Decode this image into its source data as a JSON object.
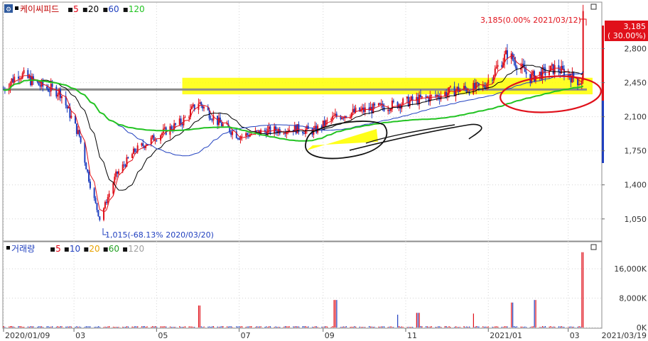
{
  "price_panel": {
    "stock_name": "케이씨피드",
    "corner_icon": "chart-settings-icon",
    "ma_legend": [
      {
        "label": "5",
        "color": "#e60012"
      },
      {
        "label": "20",
        "color": "#000000"
      },
      {
        "label": "60",
        "color": "#1f3fbf"
      },
      {
        "label": "120",
        "color": "#22c322"
      }
    ],
    "high_annotation": "3,185(0.00% 2021/03/12)",
    "low_annotation": "1,015(-68.13% 2020/03/20)",
    "current_price_tag": {
      "price": "3,185",
      "change": "( 30.00%)"
    }
  },
  "volume_panel": {
    "title": "거래량",
    "ma_legend": [
      {
        "label": "5",
        "color": "#e60012"
      },
      {
        "label": "10",
        "color": "#1f3fbf"
      },
      {
        "label": "20",
        "color": "#e8a200"
      },
      {
        "label": "60",
        "color": "#22a022"
      },
      {
        "label": "120",
        "color": "#a0a0a0"
      }
    ]
  },
  "x_axis": {
    "tick_labels": [
      "2020/01/09",
      "03",
      "05",
      "07",
      "09",
      "11",
      "2021/01",
      "03"
    ],
    "end_label": "2021/03/19"
  },
  "chart_data": [
    {
      "type": "candlestick",
      "title": "케이씨피드",
      "y_axis_ticks": [
        1050,
        1400,
        1750,
        2100,
        2450,
        2800
      ],
      "y_axis_tick_labels": [
        "1,050",
        "1,400",
        "1,750",
        "2,100",
        "2,450",
        "2,800"
      ],
      "ylim": [
        830,
        3270
      ],
      "x_range": [
        "2020/01/09",
        "2021/03/19"
      ],
      "close_series": [
        {
          "date": "2020/01/09",
          "value": 2380
        },
        {
          "date": "2020/01/20",
          "value": 2550
        },
        {
          "date": "2020/02/05",
          "value": 2420
        },
        {
          "date": "2020/02/20",
          "value": 2350
        },
        {
          "date": "2020/03/05",
          "value": 1900
        },
        {
          "date": "2020/03/13",
          "value": 1400
        },
        {
          "date": "2020/03/20",
          "value": 1050
        },
        {
          "date": "2020/04/01",
          "value": 1500
        },
        {
          "date": "2020/04/15",
          "value": 1750
        },
        {
          "date": "2020/05/01",
          "value": 1900
        },
        {
          "date": "2020/05/20",
          "value": 2050
        },
        {
          "date": "2020/06/01",
          "value": 2250
        },
        {
          "date": "2020/06/15",
          "value": 2050
        },
        {
          "date": "2020/07/01",
          "value": 1900
        },
        {
          "date": "2020/07/20",
          "value": 1950
        },
        {
          "date": "2020/08/10",
          "value": 1980
        },
        {
          "date": "2020/08/25",
          "value": 1950
        },
        {
          "date": "2020/09/10",
          "value": 2100
        },
        {
          "date": "2020/09/25",
          "value": 2150
        },
        {
          "date": "2020/10/15",
          "value": 2200
        },
        {
          "date": "2020/11/01",
          "value": 2250
        },
        {
          "date": "2020/11/20",
          "value": 2300
        },
        {
          "date": "2020/12/10",
          "value": 2380
        },
        {
          "date": "2020/12/28",
          "value": 2400
        },
        {
          "date": "2021/01/15",
          "value": 2750
        },
        {
          "date": "2021/02/01",
          "value": 2500
        },
        {
          "date": "2021/02/20",
          "value": 2600
        },
        {
          "date": "2021/03/11",
          "value": 2450
        },
        {
          "date": "2021/03/12",
          "value": 3185
        }
      ],
      "moving_averages": [
        "5",
        "20",
        "60",
        "120"
      ],
      "horizontal_level": 2380,
      "yellow_zone": [
        2330,
        2500
      ],
      "high": {
        "value": 3185,
        "change_pct": 0.0,
        "date": "2021/03/12"
      },
      "low": {
        "value": 1015,
        "change_pct": -68.13,
        "date": "2020/03/20"
      },
      "last": {
        "value": 3185,
        "change_pct": 30.0
      }
    },
    {
      "type": "bar",
      "title": "거래량",
      "y_axis_ticks": [
        0,
        8000,
        16000
      ],
      "y_axis_tick_labels": [
        "0K",
        "8,000K",
        "16,000K"
      ],
      "ylim": [
        0,
        22000
      ],
      "spikes": [
        {
          "date": "2020/06/01",
          "value": 6000
        },
        {
          "date": "2020/09/10",
          "value": 7500
        },
        {
          "date": "2020/10/25",
          "value": 3500
        },
        {
          "date": "2020/11/10",
          "value": 4000
        },
        {
          "date": "2020/12/20",
          "value": 3800
        },
        {
          "date": "2021/01/18",
          "value": 6800
        },
        {
          "date": "2021/02/05",
          "value": 7500
        },
        {
          "date": "2021/03/12",
          "value": 20500
        }
      ]
    }
  ]
}
